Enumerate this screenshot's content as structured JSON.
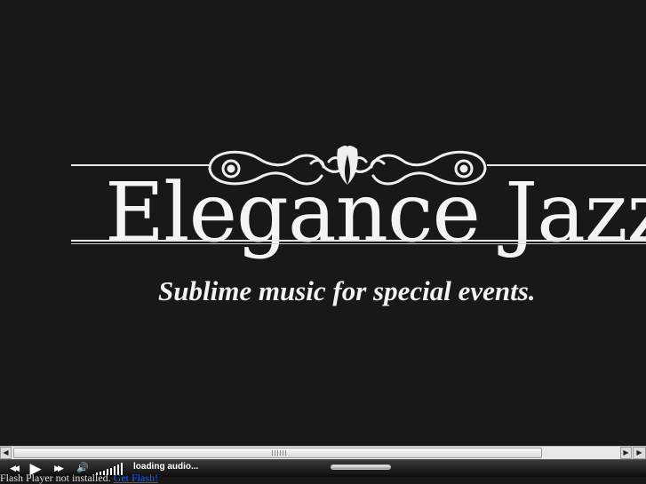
{
  "brand": {
    "title": "Elegance Jazz",
    "tagline": "Sublime music for special events."
  },
  "scrollbar": {
    "left_arrow": "◀",
    "right_arrow": "▶",
    "right_arrow_alt": "▶"
  },
  "player": {
    "prev_label": "◀◀",
    "play_label": "▶",
    "next_label": "▶▶",
    "volume_label": "🔊",
    "status": "loading audio...",
    "progress_fraction": 0.0
  },
  "flash_notice": {
    "text": "Flash Player not installed.",
    "link_text": "Get Flash!"
  },
  "colors": {
    "background": "#181818",
    "text": "#f4f4f4",
    "link": "#1a5cff"
  }
}
